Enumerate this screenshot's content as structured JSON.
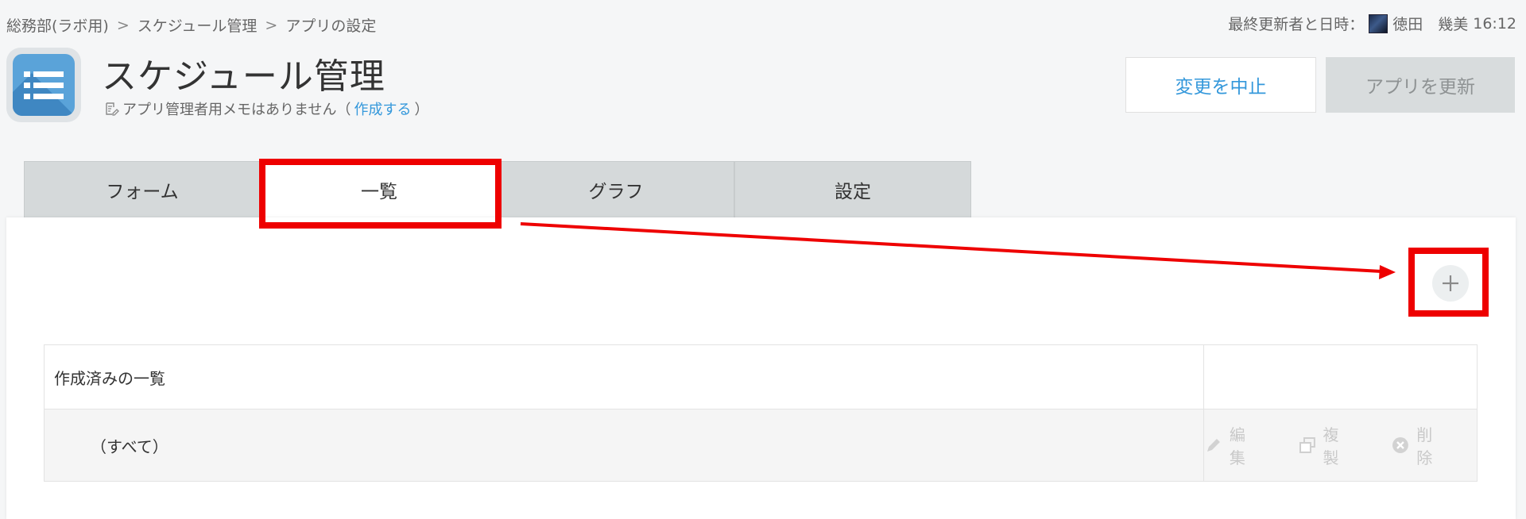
{
  "breadcrumb": {
    "items": [
      "総務部(ラボ用)",
      "スケジュール管理",
      "アプリの設定"
    ],
    "separator": ">"
  },
  "last_updated": {
    "label": "最終更新者と日時：",
    "user": "徳田　幾美",
    "time": "16:12"
  },
  "app": {
    "title": "スケジュール管理",
    "icon": "list-icon",
    "memo_text": "アプリ管理者用メモはありません（",
    "memo_link": "作成する",
    "memo_close": "）"
  },
  "header_buttons": {
    "cancel": "変更を中止",
    "update": "アプリを更新"
  },
  "tabs": [
    {
      "label": "フォーム",
      "active": false
    },
    {
      "label": "一覧",
      "active": true
    },
    {
      "label": "グラフ",
      "active": false
    },
    {
      "label": "設定",
      "active": false
    }
  ],
  "views": {
    "header": "作成済みの一覧",
    "rows": [
      {
        "name": "（すべて）",
        "actions": {
          "edit": "編集",
          "copy": "複製",
          "delete": "削除"
        }
      }
    ]
  },
  "colors": {
    "accent": "#3498db",
    "annotation": "#ee0000"
  }
}
